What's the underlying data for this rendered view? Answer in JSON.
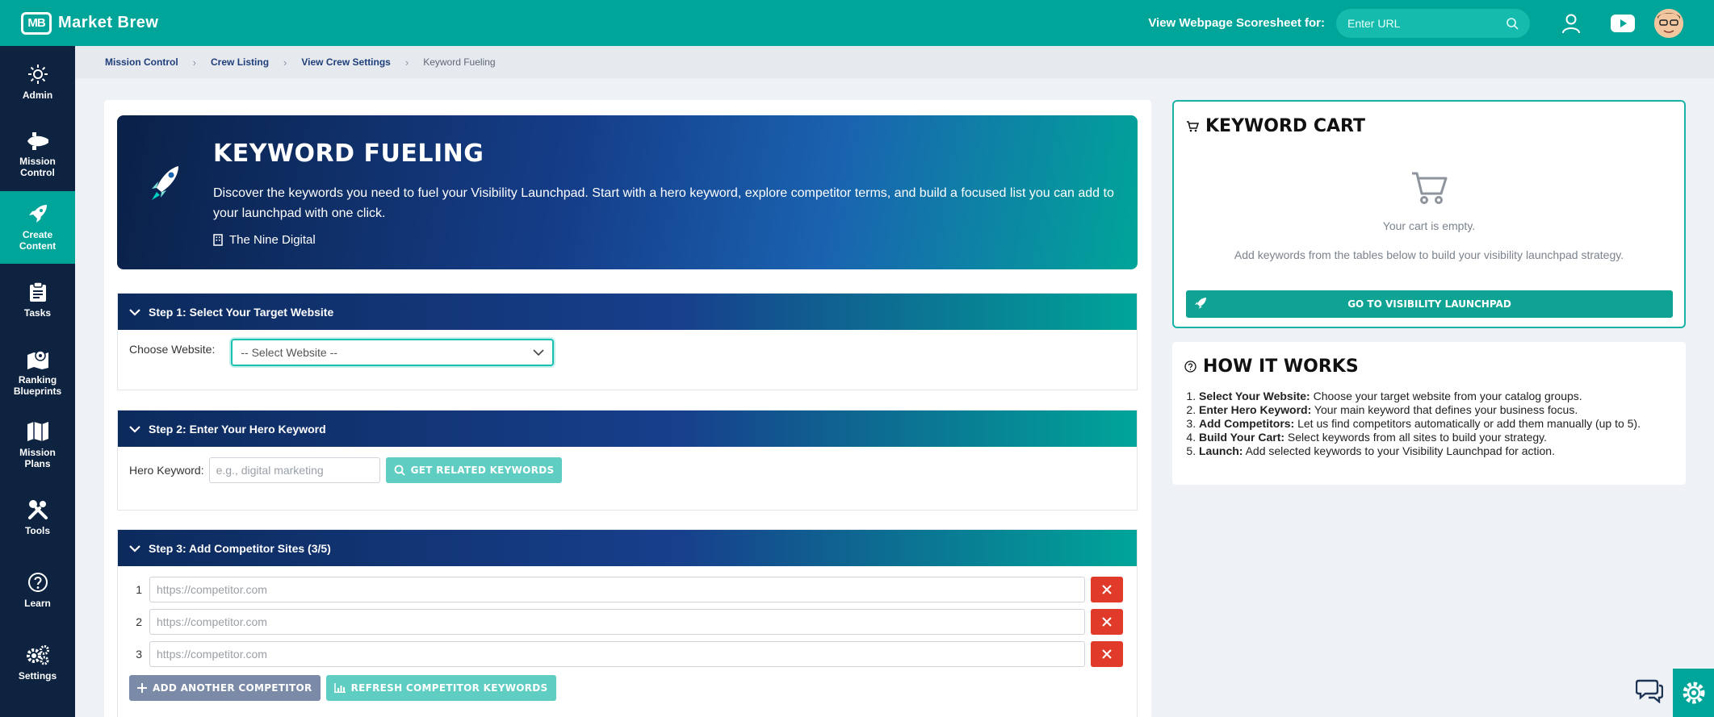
{
  "app": {
    "brand": "Market Brew",
    "logo_mark": "MB"
  },
  "topbar": {
    "scoresheet_label": "View Webpage Scoresheet for:",
    "url_placeholder": "Enter URL"
  },
  "sidebar": {
    "items": [
      {
        "label": "Admin",
        "icon": "sun-icon"
      },
      {
        "label": "Mission Control",
        "icon": "shuttle-icon"
      },
      {
        "label": "Create Content",
        "icon": "rocket-icon"
      },
      {
        "label": "Tasks",
        "icon": "clipboard-icon"
      },
      {
        "label": "Ranking Blueprints",
        "icon": "map-pin-icon"
      },
      {
        "label": "Mission Plans",
        "icon": "map-icon"
      },
      {
        "label": "Tools",
        "icon": "tools-icon"
      },
      {
        "label": "Learn",
        "icon": "question-icon"
      },
      {
        "label": "Settings",
        "icon": "gears-icon"
      }
    ]
  },
  "breadcrumb": {
    "items": [
      "Mission Control",
      "Crew Listing",
      "View Crew Settings"
    ],
    "current": "Keyword Fueling"
  },
  "hero": {
    "title": "KEYWORD FUELING",
    "description": "Discover the keywords you need to fuel your Visibility Launchpad. Start with a hero keyword, explore competitor terms, and build a focused list you can add to your launchpad with one click.",
    "organization": "The Nine Digital"
  },
  "step1": {
    "title": "Step 1: Select Your Target Website",
    "label": "Choose Website:",
    "selected": "-- Select Website --"
  },
  "step2": {
    "title": "Step 2: Enter Your Hero Keyword",
    "label": "Hero Keyword:",
    "placeholder": "e.g., digital marketing",
    "button": "GET RELATED KEYWORDS"
  },
  "step3": {
    "title": "Step 3: Add Competitor Sites (3/5)",
    "competitors": [
      {
        "num": "1",
        "placeholder": "https://competitor.com"
      },
      {
        "num": "2",
        "placeholder": "https://competitor.com"
      },
      {
        "num": "3",
        "placeholder": "https://competitor.com"
      }
    ],
    "add_button": "ADD ANOTHER COMPETITOR",
    "refresh_button": "REFRESH COMPETITOR KEYWORDS"
  },
  "cart": {
    "title": "KEYWORD CART",
    "empty": "Your cart is empty.",
    "hint": "Add keywords from the tables below to build your visibility launchpad strategy.",
    "button": "GO TO VISIBILITY LAUNCHPAD"
  },
  "how": {
    "title": "HOW IT WORKS",
    "steps": [
      {
        "bold": "Select Your Website:",
        "text": " Choose your target website from your catalog groups."
      },
      {
        "bold": "Enter Hero Keyword:",
        "text": " Your main keyword that defines your business focus."
      },
      {
        "bold": "Add Competitors:",
        "text": " Let us find competitors automatically or add them manually (up to 5)."
      },
      {
        "bold": "Build Your Cart:",
        "text": " Select keywords from all sites to build your strategy."
      },
      {
        "bold": "Launch:",
        "text": " Add selected keywords to your Visibility Launchpad for action."
      }
    ]
  },
  "colors": {
    "brand": "#00a599",
    "navy": "#0d2340",
    "danger": "#e03a2b"
  }
}
